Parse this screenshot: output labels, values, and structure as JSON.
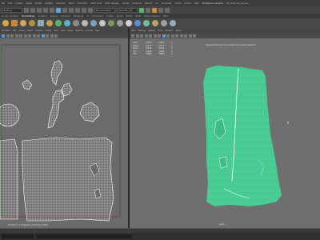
{
  "app": {
    "title_tab": "UV_Trunk_UV_Layout",
    "menus": [
      "File",
      "Edit",
      "Create",
      "Select",
      "Modify",
      "Display",
      "Windows",
      "Mesh",
      "Edit Mesh",
      "Mesh Tools",
      "Mesh Display",
      "Curves",
      "Surfaces",
      "Deform",
      "UV",
      "Generate",
      "Cache",
      "Arnold",
      "Help"
    ],
    "workspace": "Workspace: General"
  },
  "toolbar": {
    "mode_field": "Modeling",
    "live_field": "No Live Surface",
    "symmetry_field": "Symmetry: Off"
  },
  "shelf": {
    "tabs": [
      "Curves / Surfaces",
      "Poly Modeling",
      "Sculpting",
      "Rigging",
      "Animation",
      "Rendering",
      "FX",
      "FX Caching",
      "Custom",
      "Arnold",
      "Bifrost",
      "MASH",
      "Motion Graphics",
      "XGen"
    ],
    "active_tab": "Poly Modeling"
  },
  "uv_editor": {
    "menus": [
      "UV Editor",
      "Edit",
      "Create",
      "Select",
      "Cut/Sew",
      "Modify",
      "Tools",
      "View",
      "Image",
      "Textures",
      "UV Sets",
      "Help"
    ],
    "status": "UV Shell: 0 of 14 selected | UV Tiling 0 (1001)"
  },
  "viewport": {
    "menus": [
      "View",
      "Shading",
      "Lighting",
      "Show",
      "Renderer",
      "Panels"
    ],
    "hud": [
      {
        "label": "Verts:",
        "a": "15874",
        "b": "15874",
        "c": "0"
      },
      {
        "label": "Edges:",
        "a": "31575",
        "b": "31575",
        "c": "0"
      },
      {
        "label": "Faces:",
        "a": "15703",
        "b": "15703",
        "c": "0"
      },
      {
        "label": "Tris:",
        "a": "31406",
        "b": "31406",
        "c": "0"
      },
      {
        "label": "UVs:",
        "a": "16982",
        "b": "16982",
        "c": "0"
      }
    ],
    "title": "Displacement (tree trunk) | Mesh: trunk_mesh (selected)",
    "camera": "persp"
  },
  "colors": {
    "mesh_green": "#4fd39a",
    "uv_wire": "#ffffff",
    "uv_bg": "#6b6b6b",
    "viewport_bg": "#6f6f6f"
  }
}
